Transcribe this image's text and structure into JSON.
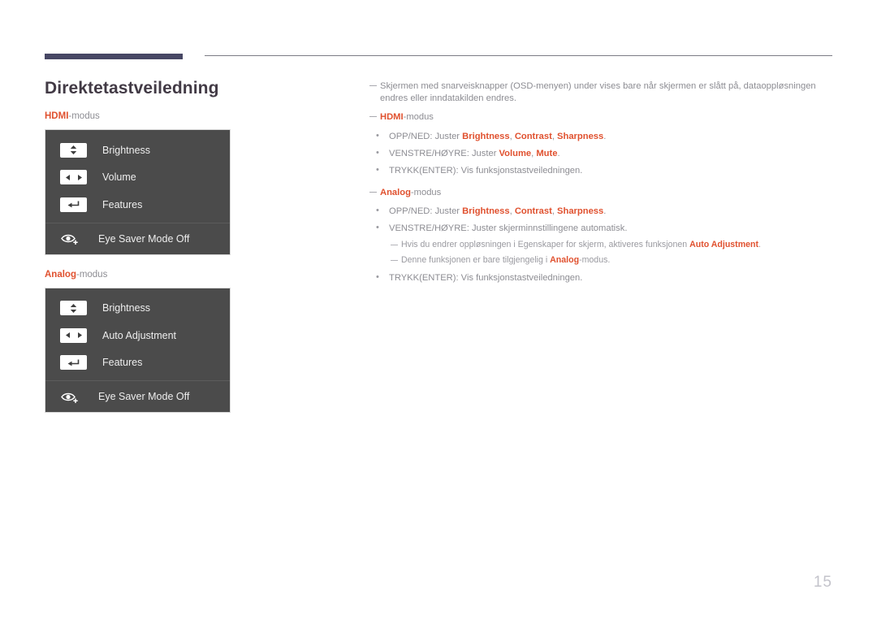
{
  "page": {
    "title": "Direktetastveiledning",
    "number": "15"
  },
  "colors": {
    "accent": "#e0512f",
    "rule_thick": "#474764",
    "rule_thin": "#7b7b85",
    "osd_background": "#4b4b4b",
    "title": "#423a45",
    "body_text": "#8d8d93",
    "page_number": "#c3c3cb"
  },
  "left": {
    "hdmi_caption": {
      "keyword": "HDMI",
      "suffix": "-modus"
    },
    "analog_caption": {
      "keyword": "Analog",
      "suffix": "-modus"
    },
    "hdmi_panel": {
      "rows": [
        {
          "icon": "up-down-arrows-icon",
          "label": "Brightness"
        },
        {
          "icon": "left-right-arrows-icon",
          "label": "Volume"
        },
        {
          "icon": "enter-return-icon",
          "label": "Features"
        }
      ],
      "eye_saver": {
        "icon": "eye-saver-icon",
        "label": "Eye Saver Mode Off"
      }
    },
    "analog_panel": {
      "rows": [
        {
          "icon": "up-down-arrows-icon",
          "label": "Brightness"
        },
        {
          "icon": "left-right-arrows-icon",
          "label": "Auto Adjustment"
        },
        {
          "icon": "enter-return-icon",
          "label": "Features"
        }
      ],
      "eye_saver": {
        "icon": "eye-saver-icon",
        "label": "Eye Saver Mode Off"
      }
    }
  },
  "right": {
    "intro_note": "Skjermen med snarveisknapper (OSD-menyen) under vises bare når skjermen er slått på, dataoppløsningen endres eller inndatakilden endres.",
    "hdmi_heading": {
      "keyword": "HDMI",
      "suffix": "-modus"
    },
    "hdmi_bullets": [
      {
        "prefix": "OPP/NED: Juster ",
        "kw1": "Brightness",
        "mid1": ", ",
        "kw2": "Contrast",
        "mid2": ", ",
        "kw3": "Sharpness",
        "suffix": "."
      },
      {
        "prefix": "VENSTRE/HØYRE: Juster ",
        "kw1": "Volume",
        "mid1": ", ",
        "kw2": "Mute",
        "suffix": "."
      },
      {
        "text": "TRYKK(ENTER): Vis funksjonstastveiledningen."
      }
    ],
    "analog_heading": {
      "keyword": "Analog",
      "suffix": "-modus"
    },
    "analog_bullets": [
      {
        "prefix": "OPP/NED: Juster ",
        "kw1": "Brightness",
        "mid1": ", ",
        "kw2": "Contrast",
        "mid2": ", ",
        "kw3": "Sharpness",
        "suffix": "."
      },
      {
        "text": "VENSTRE/HØYRE: Juster skjerminnstillingene automatisk."
      },
      {
        "text": "TRYKK(ENTER): Vis funksjonstastveiledningen."
      }
    ],
    "analog_subnotes": [
      {
        "prefix": "Hvis du endrer oppløsningen i Egenskaper for skjerm, aktiveres funksjonen ",
        "keyword": "Auto Adjustment",
        "suffix": "."
      },
      {
        "prefix": "Denne funksjonen er bare tilgjengelig i ",
        "keyword": "Analog",
        "suffix": "-modus."
      }
    ]
  }
}
